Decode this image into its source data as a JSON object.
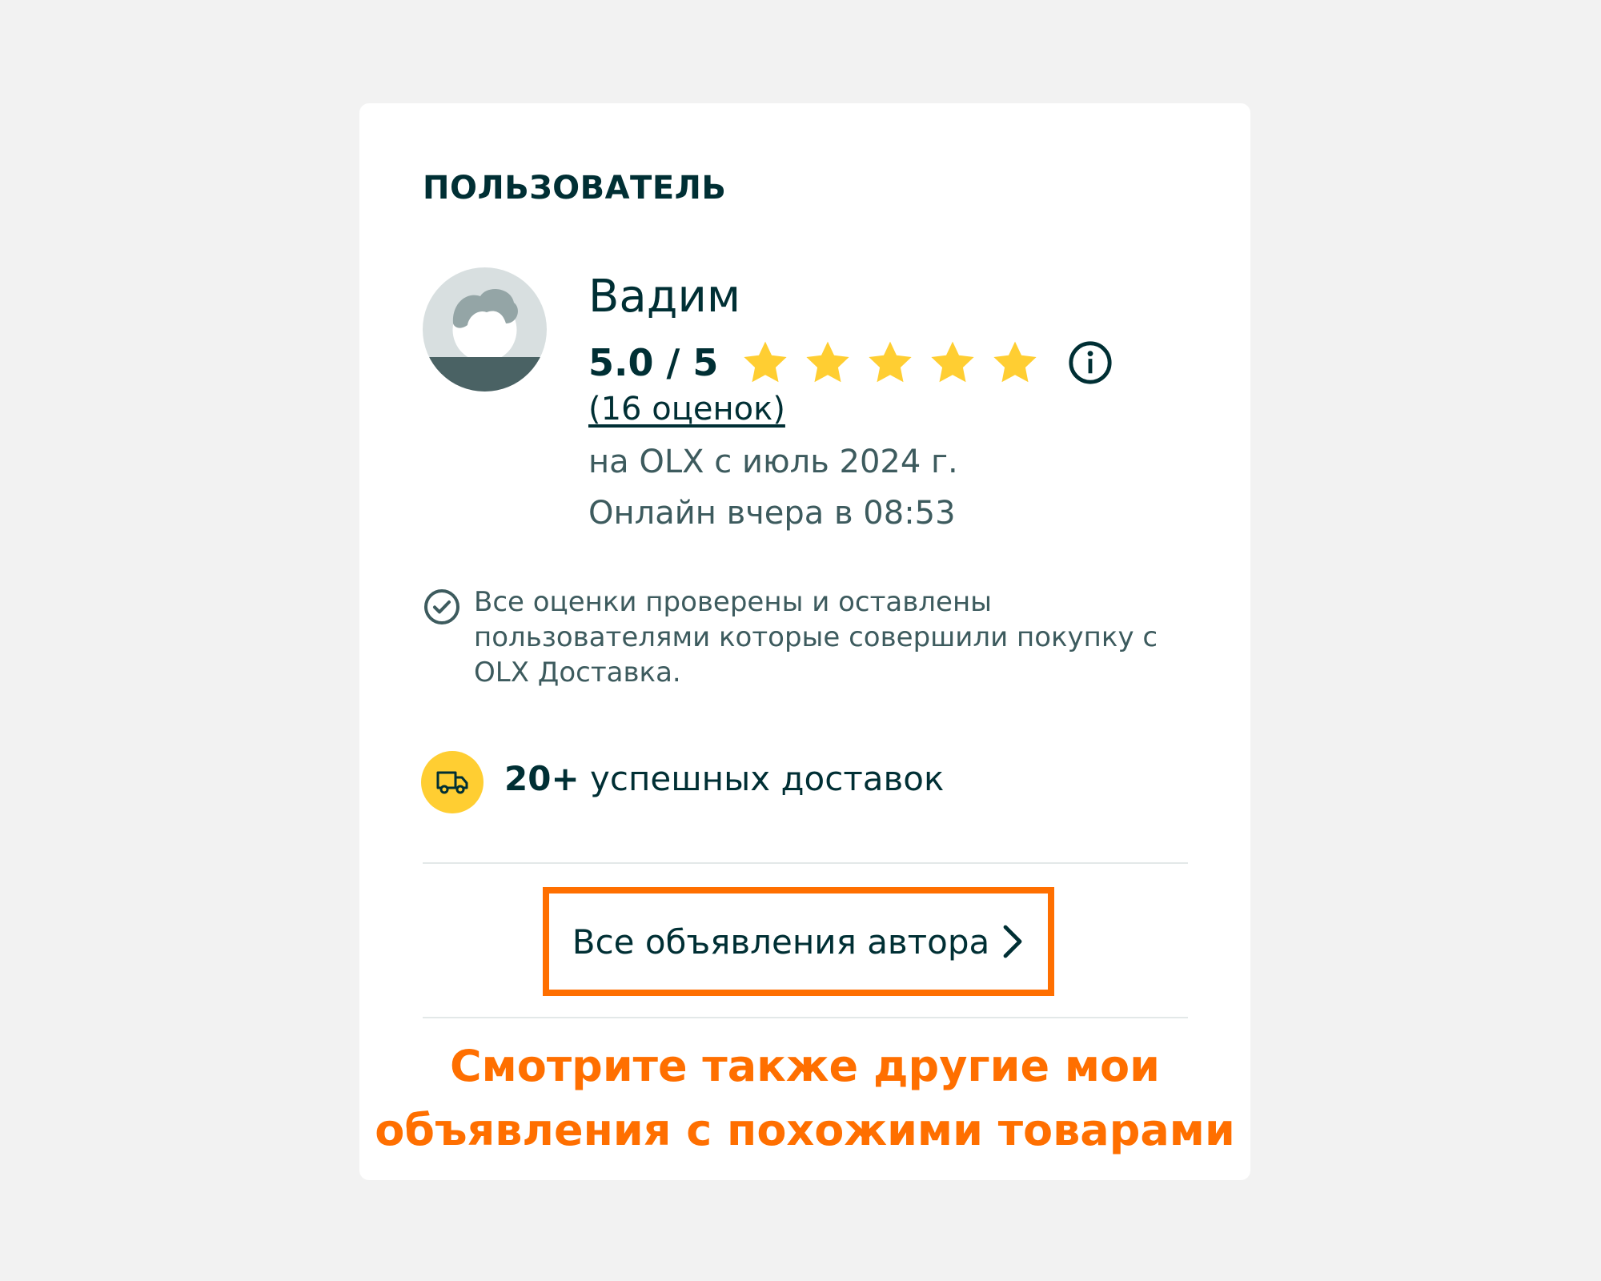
{
  "section_title": "ПОЛЬЗОВАТЕЛЬ",
  "user": {
    "name": "Вадим",
    "rating_text": "5.0 / 5",
    "rating_value": 5.0,
    "rating_max": 5,
    "reviews_link": "(16 оценок)",
    "member_since": "на OLX с июль 2024 г.",
    "last_online": "Онлайн вчера в 08:53"
  },
  "verified_note": "Все оценки проверены и оставлены пользователями которые совершили покупку с OLX Доставка.",
  "deliveries": {
    "count": "20+",
    "label": "успешных доставок"
  },
  "all_ads_button": {
    "label": "Все объявления автора"
  },
  "promo": {
    "line1": "Смотрите также другие мои",
    "line2": "объявления с похожими товарами"
  },
  "icons": {
    "star": "star-icon",
    "info": "info-icon",
    "check": "check-circle-icon",
    "delivery": "truck-icon",
    "chevron": "chevron-right-icon"
  },
  "colors": {
    "background": "#f2f2f2",
    "card": "#ffffff",
    "text_primary": "#002f34",
    "text_secondary": "#3d5b5e",
    "star": "#ffce32",
    "highlight": "#ff6f00"
  }
}
